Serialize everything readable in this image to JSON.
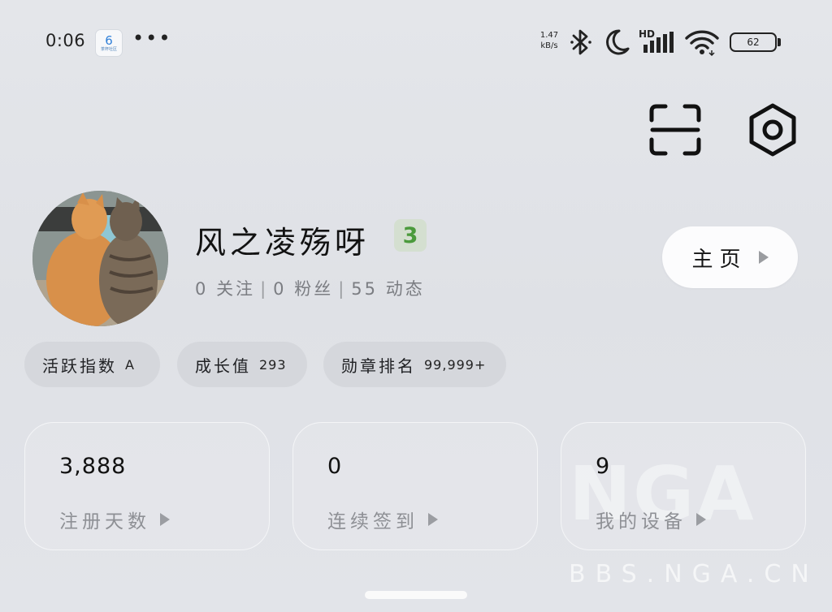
{
  "status_bar": {
    "time": "0:06",
    "app_badge_number": "6",
    "app_badge_sub": "茶杯社区",
    "more": "•••",
    "net_speed_value": "1.47",
    "net_speed_unit": "kB/s",
    "network_tag": "HD",
    "battery": "62"
  },
  "toolbar": {
    "scan_icon": "scan-icon",
    "settings_icon": "hexagon-settings-icon"
  },
  "profile": {
    "username": "风之凌殇呀",
    "level": "3",
    "stats": [
      {
        "value": "0",
        "label": "关注"
      },
      {
        "value": "0",
        "label": "粉丝"
      },
      {
        "value": "55",
        "label": "动态"
      }
    ],
    "home_button": "主页"
  },
  "tags": [
    {
      "label": "活跃指数",
      "value": "A"
    },
    {
      "label": "成长值",
      "value": "293"
    },
    {
      "label": "勋章排名",
      "value": "99,999+"
    }
  ],
  "cards": [
    {
      "value": "3,888",
      "label": "注册天数"
    },
    {
      "value": "0",
      "label": "连续签到"
    },
    {
      "value": "9",
      "label": "我的设备"
    }
  ],
  "watermark": {
    "logo": "NGA",
    "url": "BBS.NGA.CN"
  },
  "colors": {
    "background": "#e2e4e9",
    "card_border": "#f4f5f7",
    "level_badge": "#4b9a3c",
    "tag_bg": "#d5d7dc"
  }
}
